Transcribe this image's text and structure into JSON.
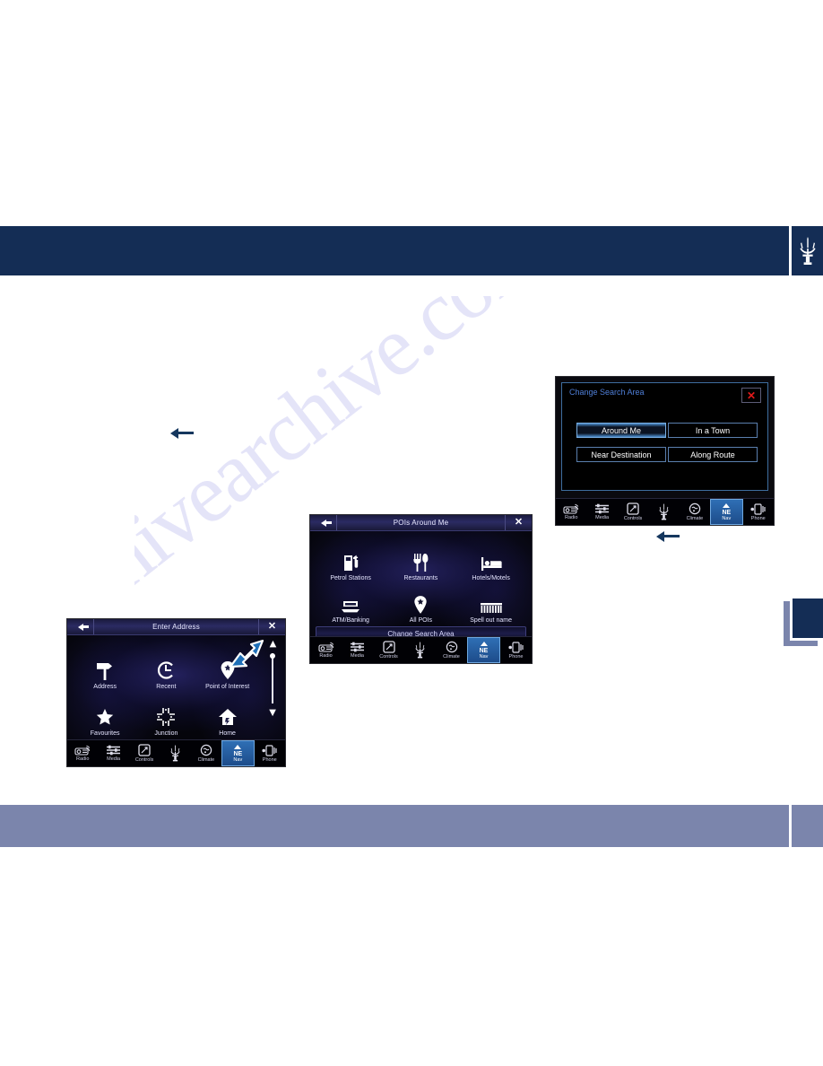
{
  "page": {
    "header": {
      "logo_icon": "maserati-trident-icon"
    },
    "footer": {},
    "watermark_text": "hivearchive.com",
    "arrows": [
      {
        "name": "flow-arrow-to-enter-address",
        "direction": "left"
      },
      {
        "name": "flow-arrow-to-pois-around-me",
        "direction": "left"
      }
    ],
    "edge_tab": {
      "name": "section-tab-marker"
    }
  },
  "nav_bar": {
    "items": [
      {
        "label": "Radio",
        "icon": "radio-icon",
        "active": false
      },
      {
        "label": "Media",
        "icon": "media-icon",
        "active": false
      },
      {
        "label": "Controls",
        "icon": "controls-icon",
        "active": false
      },
      {
        "label": "",
        "icon": "maserati-trident-icon",
        "active": false
      },
      {
        "label": "Climate",
        "icon": "climate-icon",
        "active": false
      },
      {
        "label": "Nav",
        "icon": "compass-ne-icon",
        "compass": "NE",
        "active": true
      },
      {
        "label": "Phone",
        "icon": "phone-icon",
        "active": false
      }
    ]
  },
  "screen_enter_address": {
    "title": "Enter Address",
    "back_icon": "back-arrow-icon",
    "close_icon": "close-x-icon",
    "tiles": [
      {
        "label": "Address",
        "icon": "signpost-icon"
      },
      {
        "label": "Recent",
        "icon": "clock-icon"
      },
      {
        "label": "Point of Interest",
        "icon": "map-pin-star-icon"
      },
      {
        "label": "Favourites",
        "icon": "star-icon"
      },
      {
        "label": "Junction",
        "icon": "crossroads-icon"
      },
      {
        "label": "Home",
        "icon": "home-icon"
      }
    ],
    "scroll": {
      "up_icon": "scroll-up-triangle-icon",
      "down_icon": "scroll-down-triangle-icon"
    },
    "cursor_icon": "pointer-arrow-icon"
  },
  "screen_pois_around_me": {
    "title": "POIs Around Me",
    "back_icon": "back-arrow-icon",
    "close_icon": "close-x-icon",
    "tiles": [
      {
        "label": "Petrol Stations",
        "icon": "fuel-pump-icon"
      },
      {
        "label": "Restaurants",
        "icon": "cutlery-icon"
      },
      {
        "label": "Hotels/Motels",
        "icon": "bed-icon"
      },
      {
        "label": "ATM/Banking",
        "icon": "atm-icon"
      },
      {
        "label": "All POIs",
        "icon": "map-pin-star-icon"
      },
      {
        "label": "Spell out name",
        "icon": "keyboard-icon"
      }
    ],
    "wide_button": "Change Search Area"
  },
  "screen_change_search_area": {
    "title": "Change Search Area",
    "close_icon": "close-x-icon",
    "close_color": "#e01a1a",
    "options": [
      {
        "label": "Around Me",
        "selected": true
      },
      {
        "label": "In a Town",
        "selected": false
      },
      {
        "label": "Near Destination",
        "selected": false
      },
      {
        "label": "Along Route",
        "selected": false
      }
    ]
  },
  "colors": {
    "header_navy": "#142d55",
    "footer_blue_grey": "#7b85ac",
    "hmi_accent_blue": "#4d8fd0",
    "close_red": "#e01a1a"
  }
}
